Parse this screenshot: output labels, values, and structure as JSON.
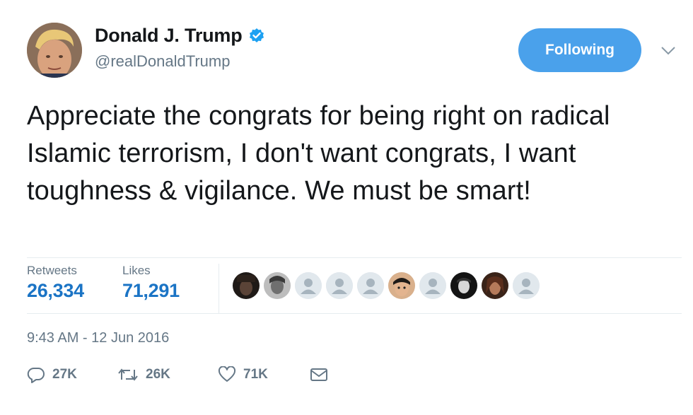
{
  "author": {
    "display_name": "Donald J. Trump",
    "handle": "@realDonaldTrump",
    "verified_icon": "verified-badge-icon",
    "avatar": "profile-photo"
  },
  "follow_button": {
    "label": "Following"
  },
  "menu": {
    "icon": "chevron-down-icon"
  },
  "tweet": {
    "text": "Appreciate the congrats for being right on radical Islamic terrorism, I don't want congrats, I want toughness & vigilance. We must be smart!"
  },
  "stats": {
    "retweets_label": "Retweets",
    "retweets_value": "26,334",
    "likes_label": "Likes",
    "likes_value": "71,291"
  },
  "likers": [
    "liker-photo",
    "liker-photo",
    "default-avatar-icon",
    "default-avatar-icon",
    "default-avatar-icon",
    "liker-photo",
    "default-avatar-icon",
    "liker-photo",
    "liker-photo",
    "default-avatar-icon"
  ],
  "timestamp": "9:43 AM - 12 Jun 2016",
  "actions": {
    "reply_count": "27K",
    "retweet_count": "26K",
    "like_count": "71K"
  },
  "colors": {
    "accent": "#4aa1eb",
    "link": "#1b74c5",
    "muted": "#657786",
    "text": "#14171a",
    "divider": "#e6ecf0"
  }
}
